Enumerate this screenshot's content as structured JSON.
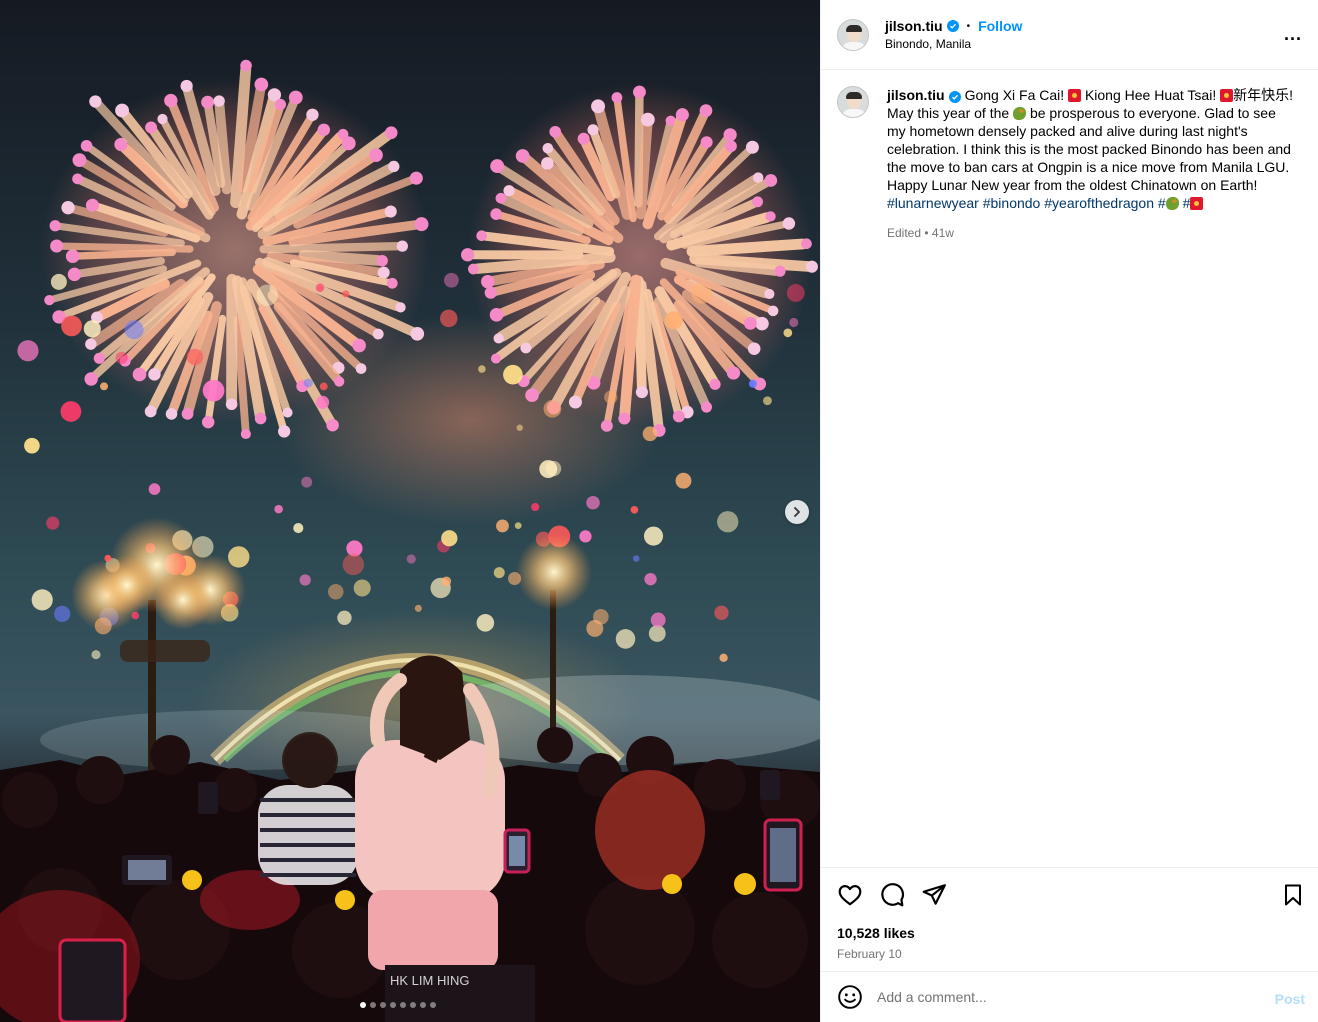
{
  "post": {
    "username": "jilson.tiu",
    "follow_label": "Follow",
    "separator": "•",
    "location": "Binondo, Manila",
    "more_label": "...",
    "media": {
      "image_alt": "Crowd watching fireworks at night in Binondo",
      "slide_count": 8,
      "active_slide": 1,
      "next_icon": "chevron-right-icon",
      "shirt_text": "HK LIM HING"
    },
    "caption": {
      "part1": "Gong Xi Fa Cai! ",
      "part2": " Kiong Hee Huat Tsai! ",
      "part3": "新年快乐! May this year of the ",
      "part4": " be prosperous to everyone. Glad to see my hometown densely packed and alive during last night's celebration. I think this is the most packed Binondo has been and the move to ban cars at Ongpin is a nice move from Manila LGU. Happy Lunar New year from the oldest Chinatown on Earth!",
      "hashtags": [
        "#lunarnewyear",
        "#binondo",
        "#yearofthedragon",
        "#",
        "#"
      ],
      "emoji_envelope": "red-envelope-emoji",
      "emoji_dragon": "dragon-emoji"
    },
    "edited_label": "Edited",
    "edited_sep": " • ",
    "edited_age": "41w",
    "likes": "10,528 likes",
    "date": "February 10",
    "comment_placeholder": "Add a comment...",
    "post_label": "Post",
    "icons": [
      "heart-icon",
      "comment-icon",
      "share-icon",
      "bookmark-icon",
      "emoji-icon",
      "more-icon",
      "verified-icon"
    ],
    "colors": {
      "accent": "#0095f6",
      "hashtag": "#00376b",
      "muted": "#737373",
      "post_disabled": "#b2dffc"
    }
  }
}
